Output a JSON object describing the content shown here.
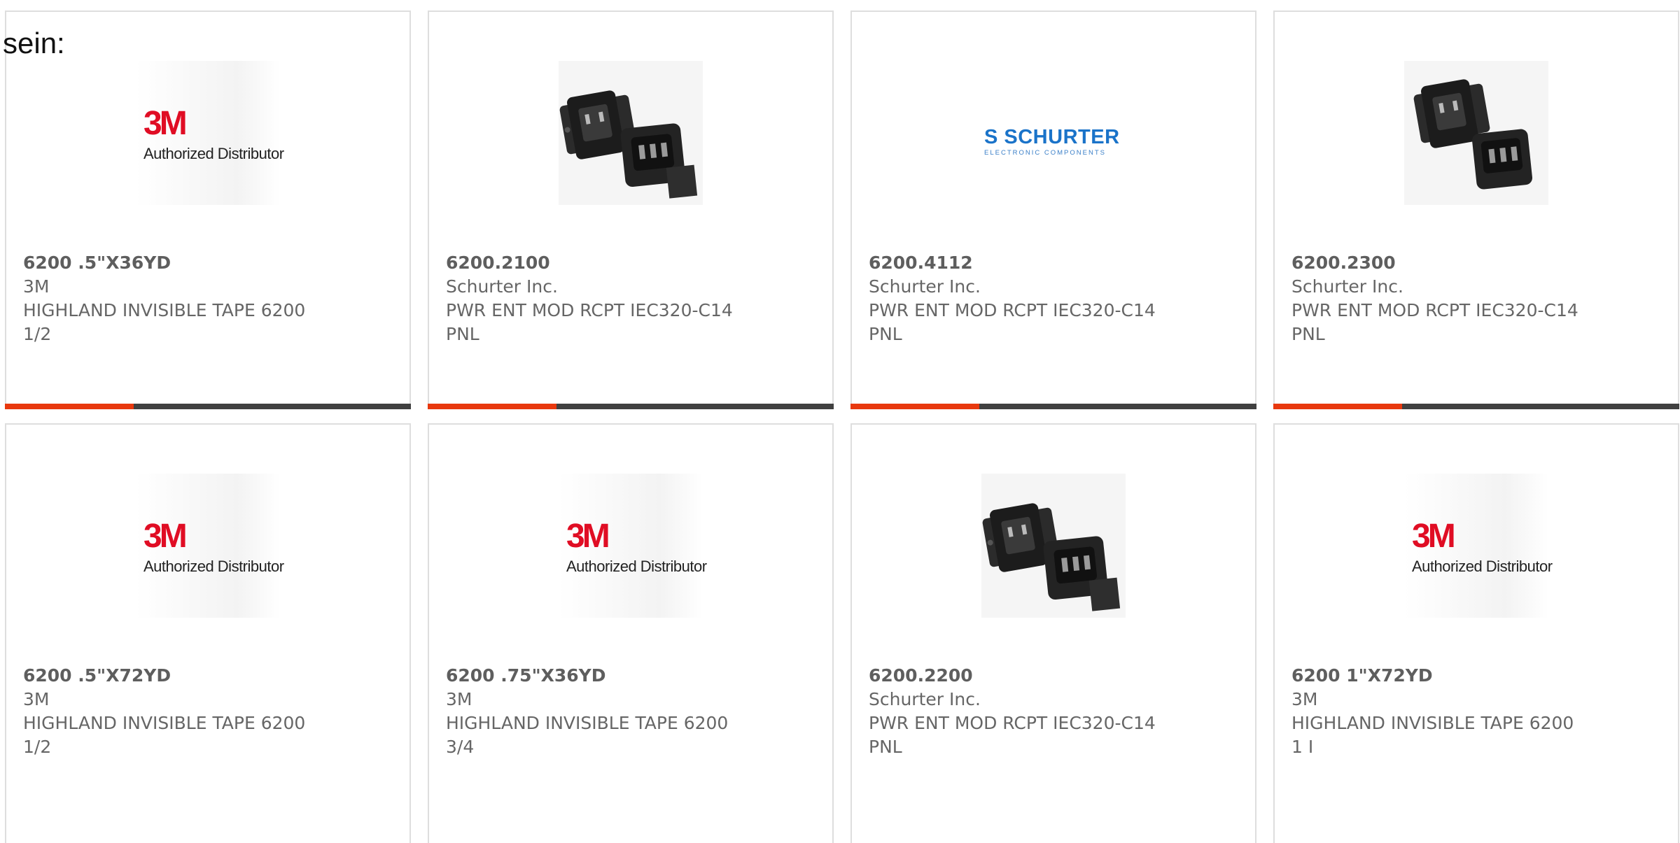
{
  "intro_text": "sein:",
  "brand_labels": {
    "3m_logo": "3M",
    "3m_sub": "Authorized Distributor",
    "schurter_logo": "S SCHURTER",
    "schurter_sub": "ELECTRONIC COMPONENTS"
  },
  "colors": {
    "accent_bar": "#e8380e",
    "bar_base": "#404040",
    "brand_3m_red": "#e00d24",
    "schurter_blue": "#1a73c9"
  },
  "products": [
    {
      "part_number": "6200 .5\"X36YD",
      "manufacturer": "3M",
      "desc_line1": "HIGHLAND INVISIBLE TAPE 6200",
      "desc_line2": "1/2",
      "image": "3m-authorized-distributor-logo"
    },
    {
      "part_number": "6200.2100",
      "manufacturer": "Schurter Inc.",
      "desc_line1": "PWR ENT MOD RCPT IEC320-C14",
      "desc_line2": "PNL",
      "image": "power-entry-module-photo"
    },
    {
      "part_number": "6200.4112",
      "manufacturer": "Schurter Inc.",
      "desc_line1": "PWR ENT MOD RCPT IEC320-C14",
      "desc_line2": "PNL",
      "image": "schurter-logo"
    },
    {
      "part_number": "6200.2300",
      "manufacturer": "Schurter Inc.",
      "desc_line1": "PWR ENT MOD RCPT IEC320-C14",
      "desc_line2": "PNL",
      "image": "power-entry-module-photo"
    },
    {
      "part_number": "6200 .5\"X72YD",
      "manufacturer": "3M",
      "desc_line1": "HIGHLAND INVISIBLE TAPE 6200",
      "desc_line2": "1/2",
      "image": "3m-authorized-distributor-logo"
    },
    {
      "part_number": "6200 .75\"X36YD",
      "manufacturer": "3M",
      "desc_line1": "HIGHLAND INVISIBLE TAPE 6200",
      "desc_line2": "3/4",
      "image": "3m-authorized-distributor-logo"
    },
    {
      "part_number": "6200.2200",
      "manufacturer": "Schurter Inc.",
      "desc_line1": "PWR ENT MOD RCPT IEC320-C14",
      "desc_line2": "PNL",
      "image": "power-entry-module-photo"
    },
    {
      "part_number": "6200 1\"X72YD",
      "manufacturer": "3M",
      "desc_line1": "HIGHLAND INVISIBLE TAPE 6200",
      "desc_line2": "1 I",
      "image": "3m-authorized-distributor-logo"
    }
  ]
}
